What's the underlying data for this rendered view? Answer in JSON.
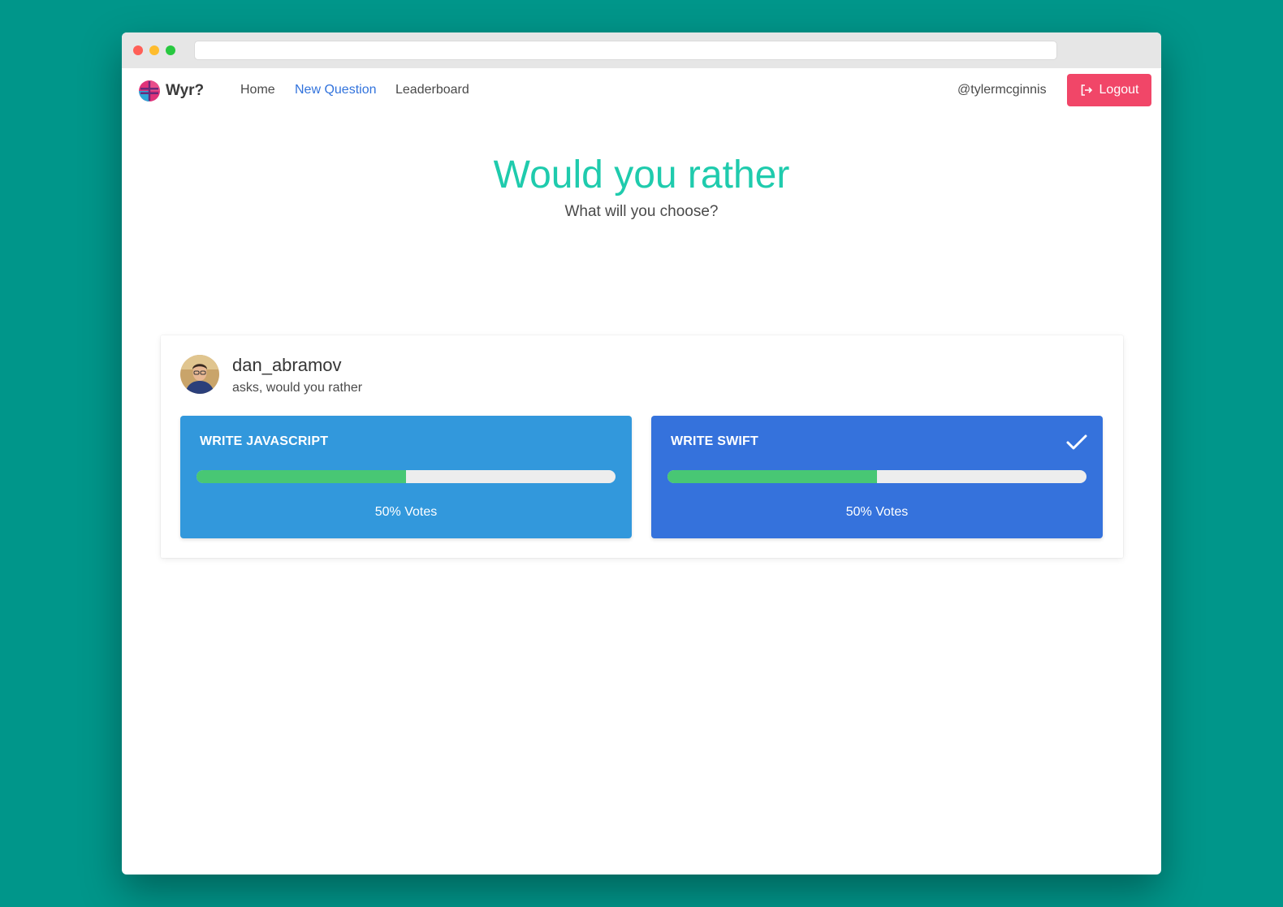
{
  "browser": {
    "url": ""
  },
  "navbar": {
    "brand": "Wyr?",
    "links": [
      {
        "label": "Home",
        "active": false
      },
      {
        "label": "New Question",
        "active": true
      },
      {
        "label": "Leaderboard",
        "active": false
      }
    ],
    "username": "@tylermcginnis",
    "logout_label": "Logout"
  },
  "hero": {
    "title": "Would you rather",
    "subtitle": "What will you choose?"
  },
  "question": {
    "author": "dan_abramov",
    "asks": "asks, would you rather",
    "options": [
      {
        "label": "WRITE JAVASCRIPT",
        "votes_text": "50% Votes",
        "percent": 50,
        "selected": false
      },
      {
        "label": "WRITE SWIFT",
        "votes_text": "50% Votes",
        "percent": 50,
        "selected": true
      }
    ]
  },
  "colors": {
    "accent": "#1fcbad",
    "option_one": "#3298dc",
    "option_two": "#3572dc",
    "progress": "#48c774",
    "logout": "#f14668"
  },
  "icons": {
    "logo": "wyr-logo-icon",
    "logout": "logout-icon",
    "selected": "checkmark-icon"
  }
}
